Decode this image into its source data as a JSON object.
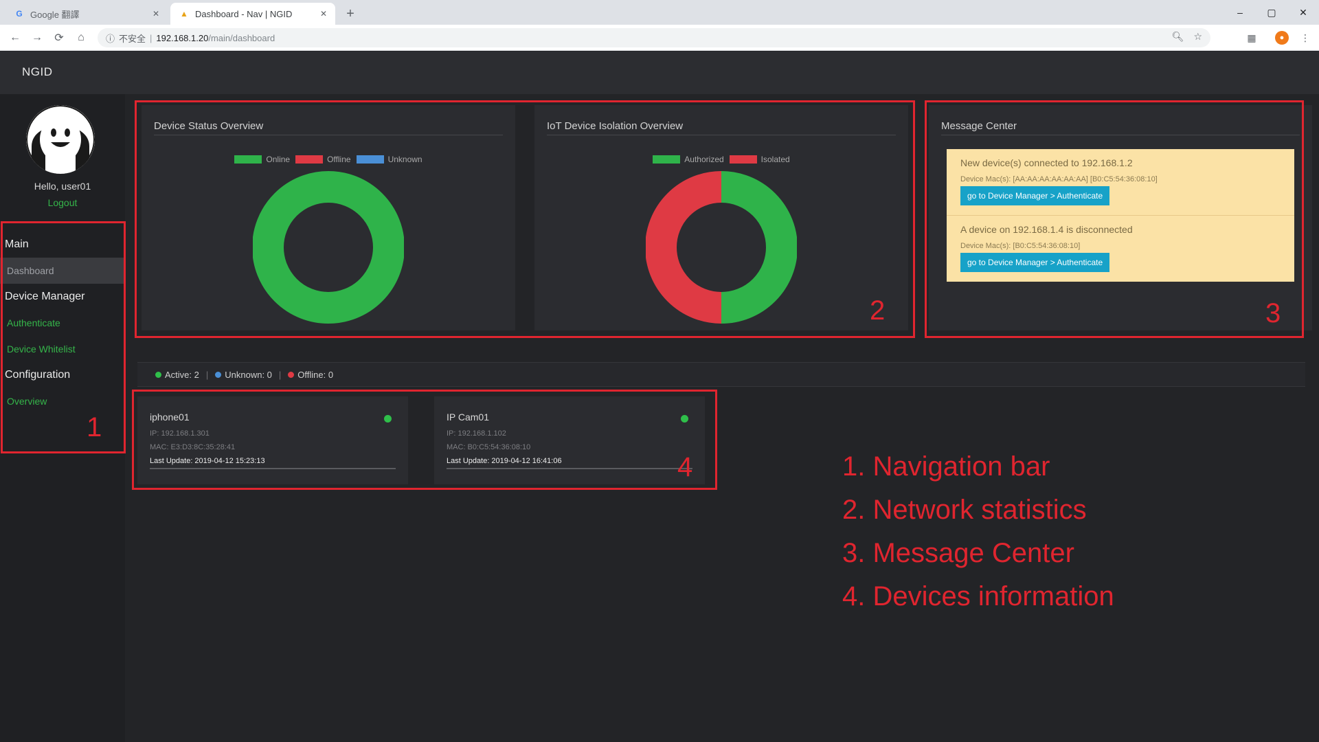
{
  "browser": {
    "tabs": [
      {
        "title": "Google 翻譯",
        "close": "✕"
      },
      {
        "title": "Dashboard - Nav | NGID",
        "close": "✕"
      }
    ],
    "new_tab": "+",
    "window_controls": {
      "minimize": "–",
      "maximize": "▢",
      "close": "✕"
    },
    "address": {
      "secure_label": "不安全",
      "host": "192.168.1.20",
      "path": "/main/dashboard"
    }
  },
  "app": {
    "brand": "NGID",
    "user": {
      "greeting": "Hello, user01",
      "logout": "Logout"
    },
    "nav": [
      {
        "type": "section",
        "label": "Main"
      },
      {
        "type": "item",
        "label": "Dashboard",
        "active": true
      },
      {
        "type": "section",
        "label": "Device Manager"
      },
      {
        "type": "item",
        "label": "Authenticate"
      },
      {
        "type": "item",
        "label": "Device Whitelist"
      },
      {
        "type": "section",
        "label": "Configuration"
      },
      {
        "type": "item",
        "label": "Overview"
      }
    ],
    "device_status": {
      "title": "Device Status Overview",
      "legend": [
        {
          "label": "Online",
          "color": "#2fb34a"
        },
        {
          "label": "Offline",
          "color": "#df3a44"
        },
        {
          "label": "Unknown",
          "color": "#4a8fd6"
        }
      ],
      "chart_data": {
        "type": "pie",
        "categories": [
          "Online",
          "Offline",
          "Unknown"
        ],
        "values": [
          2,
          0,
          0
        ],
        "colors": [
          "#2fb34a",
          "#df3a44",
          "#4a8fd6"
        ]
      }
    },
    "isolation": {
      "title": "IoT Device Isolation Overview",
      "legend": [
        {
          "label": "Authorized",
          "color": "#2fb34a"
        },
        {
          "label": "Isolated",
          "color": "#df3a44"
        }
      ],
      "chart_data": {
        "type": "pie",
        "categories": [
          "Authorized",
          "Isolated"
        ],
        "values": [
          1,
          1
        ],
        "colors": [
          "#2fb34a",
          "#df3a44"
        ]
      }
    },
    "message_center": {
      "title": "Message Center",
      "messages": [
        {
          "text": "New device(s) connected to 192.168.1.2",
          "detail": "Device Mac(s): [AA:AA:AA:AA:AA:AA] [B0:C5:54:36:08:10]",
          "button": "go to Device Manager > Authenticate"
        },
        {
          "text": "A device on 192.168.1.4 is disconnected",
          "detail": "Device Mac(s): [B0:C5:54:36:08:10]",
          "button": "go to Device Manager > Authenticate"
        }
      ]
    },
    "status_summary": {
      "active": {
        "label": "Active: 2",
        "color": "#2fbf4a"
      },
      "unknown": {
        "label": "Unknown: 0",
        "color": "#4a8fd6"
      },
      "offline": {
        "label": "Offline: 0",
        "color": "#df3a44"
      }
    },
    "devices": [
      {
        "name": "iphone01",
        "ip": "IP: 192.168.1.301",
        "mac": "MAC: E3:D3:8C:35:28:41",
        "update": "Last Update: 2019-04-12 15:23:13",
        "status_color": "#2fbf4a"
      },
      {
        "name": "IP Cam01",
        "ip": "IP: 192.168.1.102",
        "mac": "MAC: B0:C5:54:36:08:10",
        "update": "Last Update: 2019-04-12 16:41:06",
        "status_color": "#2fbf4a"
      }
    ]
  },
  "annotations": {
    "numbers": [
      "1",
      "2",
      "3",
      "4"
    ],
    "legend": [
      "1. Navigation bar",
      "2. Network statistics",
      "3. Message Center",
      "4. Devices information"
    ],
    "color": "#e0252f"
  }
}
